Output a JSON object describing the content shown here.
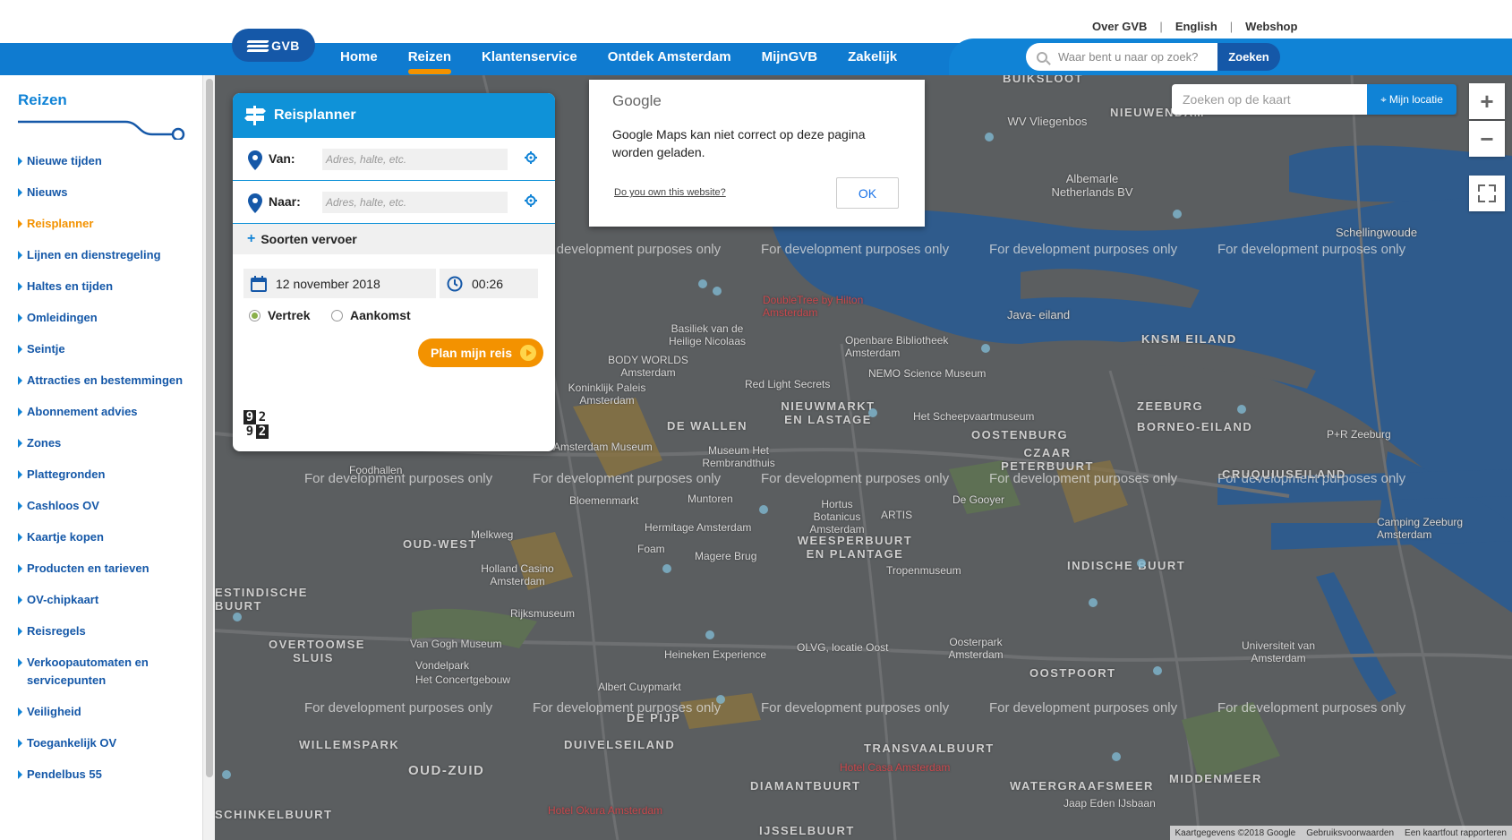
{
  "header": {
    "top_links": [
      "Over GVB",
      "English",
      "Webshop"
    ],
    "logo_text": "GVB",
    "nav": [
      {
        "label": "Home",
        "active": false
      },
      {
        "label": "Reizen",
        "active": true
      },
      {
        "label": "Klantenservice",
        "active": false
      },
      {
        "label": "Ontdek Amsterdam",
        "active": false
      },
      {
        "label": "MijnGVB",
        "active": false
      },
      {
        "label": "Zakelijk",
        "active": false
      }
    ],
    "search": {
      "placeholder": "Waar bent u naar op zoek?",
      "button": "Zoeken"
    },
    "accent_color": "#f39200",
    "brand_color": "#1083d6"
  },
  "sidebar": {
    "title": "Reizen",
    "items": [
      {
        "label": "Nieuwe tijden"
      },
      {
        "label": "Nieuws"
      },
      {
        "label": "Reisplanner",
        "active": true
      },
      {
        "label": "Lijnen en dienstregeling"
      },
      {
        "label": "Haltes en tijden"
      },
      {
        "label": "Omleidingen"
      },
      {
        "label": "Seintje"
      },
      {
        "label": "Attracties en bestemmingen"
      },
      {
        "label": "Abonnement advies"
      },
      {
        "label": "Zones"
      },
      {
        "label": "Plattegronden"
      },
      {
        "label": "Cashloos OV"
      },
      {
        "label": "Kaartje kopen"
      },
      {
        "label": "Producten en tarieven"
      },
      {
        "label": "OV-chipkaart"
      },
      {
        "label": "Reisregels"
      },
      {
        "label": "Verkoopautomaten en servicepunten"
      },
      {
        "label": "Veiligheid"
      },
      {
        "label": "Toegankelijk OV"
      },
      {
        "label": "Pendelbus 55"
      }
    ]
  },
  "planner": {
    "title": "Reisplanner",
    "from_label": "Van:",
    "to_label": "Naar:",
    "from_placeholder": "Adres, halte, etc.",
    "to_placeholder": "Adres, halte, etc.",
    "transport_toggle": "Soorten vervoer",
    "date": "12 november 2018",
    "time": "00:26",
    "departure_label": "Vertrek",
    "arrival_label": "Aankomst",
    "selected": "Vertrek",
    "plan_button": "Plan mijn reis",
    "counter_top": [
      "9",
      "2"
    ],
    "counter_bottom": [
      "9",
      "2"
    ]
  },
  "google_dialog": {
    "logo": "Google",
    "message": "Google Maps kan niet correct op deze pagina worden geladen.",
    "own_link": "Do you own this website?",
    "ok_button": "OK"
  },
  "map": {
    "search_placeholder": "Zoeken op de kaart",
    "locate_button": "Mijn locatie",
    "zoom_in": "+",
    "zoom_out": "−",
    "watermark": "For development purposes only",
    "attribution": [
      "Kaartgegevens ©2018 Google",
      "Gebruiksvoorwaarden",
      "Een kaartfout rapporteren"
    ],
    "labels": [
      {
        "text": "BUIKSLOOT",
        "kind": "district"
      },
      {
        "text": "NIEUWENDAM",
        "kind": "district"
      },
      {
        "text": "WV Vliegenbos",
        "kind": "poi"
      },
      {
        "text": "Albemarle Netherlands BV",
        "kind": "poi"
      },
      {
        "text": "Schellingwoude",
        "kind": "poi"
      },
      {
        "text": "Java- eiland",
        "kind": "poi"
      },
      {
        "text": "KNSM EILAND",
        "kind": "district"
      },
      {
        "text": "DoubleTree by Hilton Amsterdam",
        "kind": "hotel"
      },
      {
        "text": "Basiliek van de Heilige Nicolaas",
        "kind": "poi"
      },
      {
        "text": "Openbare Bibliotheek Amsterdam",
        "kind": "poi"
      },
      {
        "text": "NEMO Science Museum",
        "kind": "poi"
      },
      {
        "text": "BODY WORLDS Amsterdam",
        "kind": "poi"
      },
      {
        "text": "Koninklijk Paleis Amsterdam",
        "kind": "poi"
      },
      {
        "text": "Red Light Secrets",
        "kind": "poi"
      },
      {
        "text": "NIEUWMARKT EN LASTAGE",
        "kind": "district"
      },
      {
        "text": "Het Scheepvaartmuseum",
        "kind": "poi"
      },
      {
        "text": "ZEEBURG",
        "kind": "district"
      },
      {
        "text": "BORNEO-EILAND",
        "kind": "district"
      },
      {
        "text": "DE WALLEN",
        "kind": "district"
      },
      {
        "text": "OOSTENBURG",
        "kind": "district"
      },
      {
        "text": "CZAAR PETERBUURT",
        "kind": "district"
      },
      {
        "text": "P+R Zeeburg",
        "kind": "poi"
      },
      {
        "text": "Museum Het Rembrandthuis",
        "kind": "poi"
      },
      {
        "text": "Amsterdam Museum",
        "kind": "poi"
      },
      {
        "text": "CRUQUIUSEILAND",
        "kind": "district"
      },
      {
        "text": "Foodhallen",
        "kind": "poi"
      },
      {
        "text": "Bloemenmarkt",
        "kind": "poi"
      },
      {
        "text": "Muntoren",
        "kind": "poi"
      },
      {
        "text": "Hortus Botanicus Amsterdam",
        "kind": "poi"
      },
      {
        "text": "ARTIS",
        "kind": "poi"
      },
      {
        "text": "De Gooyer",
        "kind": "poi"
      },
      {
        "text": "Camping Zeeburg Amsterdam",
        "kind": "poi"
      },
      {
        "text": "OUD-WEST",
        "kind": "district"
      },
      {
        "text": "Melkweg",
        "kind": "poi"
      },
      {
        "text": "Hermitage Amsterdam",
        "kind": "poi"
      },
      {
        "text": "Foam",
        "kind": "poi"
      },
      {
        "text": "Magere Brug",
        "kind": "poi"
      },
      {
        "text": "WEESPERBUURT EN PLANTAGE",
        "kind": "district"
      },
      {
        "text": "INDISCHE BUURT",
        "kind": "district"
      },
      {
        "text": "Holland Casino Amsterdam",
        "kind": "poi"
      },
      {
        "text": "Tropenmuseum",
        "kind": "poi"
      },
      {
        "text": "ESTINDISCHE BUURT",
        "kind": "district"
      },
      {
        "text": "Rijksmuseum",
        "kind": "poi"
      },
      {
        "text": "OVERTOOMSE SLUIS",
        "kind": "district"
      },
      {
        "text": "Van Gogh Museum",
        "kind": "poi"
      },
      {
        "text": "Vondelpark",
        "kind": "poi"
      },
      {
        "text": "Heineken Experience",
        "kind": "poi"
      },
      {
        "text": "OLVG, locatie Oost",
        "kind": "poi"
      },
      {
        "text": "Oosterpark Amsterdam",
        "kind": "poi"
      },
      {
        "text": "Universiteit van Amsterdam",
        "kind": "poi"
      },
      {
        "text": "Het Concertgebouw",
        "kind": "poi"
      },
      {
        "text": "Albert Cuypmarkt",
        "kind": "poi"
      },
      {
        "text": "OOSTPOORT",
        "kind": "district"
      },
      {
        "text": "DE PIJP",
        "kind": "district"
      },
      {
        "text": "WILLEMSPARK",
        "kind": "district"
      },
      {
        "text": "DUIVELSEILAND",
        "kind": "district"
      },
      {
        "text": "TRANSVAALBUURT",
        "kind": "district"
      },
      {
        "text": "OUD-ZUID",
        "kind": "district"
      },
      {
        "text": "Hotel Casa Amsterdam",
        "kind": "hotel"
      },
      {
        "text": "DIAMANTBUURT",
        "kind": "district"
      },
      {
        "text": "WATERGRAAFSMEER",
        "kind": "district"
      },
      {
        "text": "MIDDENMEER",
        "kind": "district"
      },
      {
        "text": "Jaap Eden IJsbaan",
        "kind": "poi"
      },
      {
        "text": "Hotel Okura Amsterdam",
        "kind": "hotel"
      },
      {
        "text": "SCHINKELBUURT",
        "kind": "district"
      },
      {
        "text": "IJSSELBUURT",
        "kind": "district"
      }
    ]
  }
}
